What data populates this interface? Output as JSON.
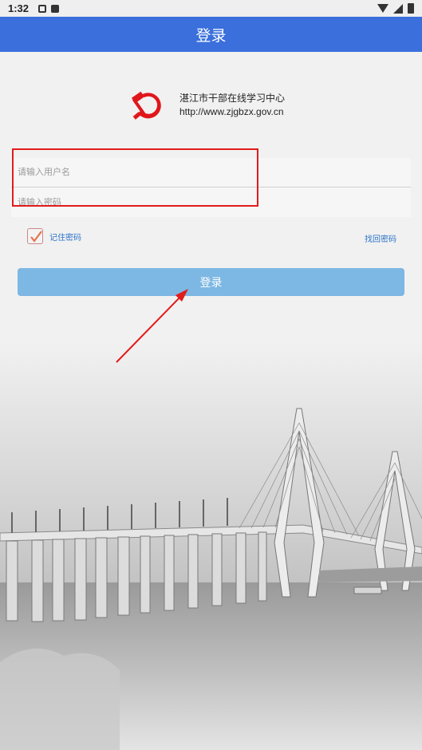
{
  "status_bar": {
    "time": "1:32"
  },
  "app_bar": {
    "title": "登录"
  },
  "org": {
    "name": "湛江市干部在线学习中心",
    "url": "http://www.zjgbzx.gov.cn",
    "logo_icon": "party-emblem-icon"
  },
  "form": {
    "username_placeholder": "请输入用户名",
    "password_placeholder": "请输入密码",
    "remember_label": "记住密码",
    "remember_checked": true,
    "forgot_label": "找回密码",
    "login_label": "登录"
  },
  "colors": {
    "app_bar": "#3a6fdc",
    "login_button": "#7db7e3",
    "link": "#2d74c9",
    "annotation": "#e21b1b",
    "emblem": "#e0161b"
  }
}
